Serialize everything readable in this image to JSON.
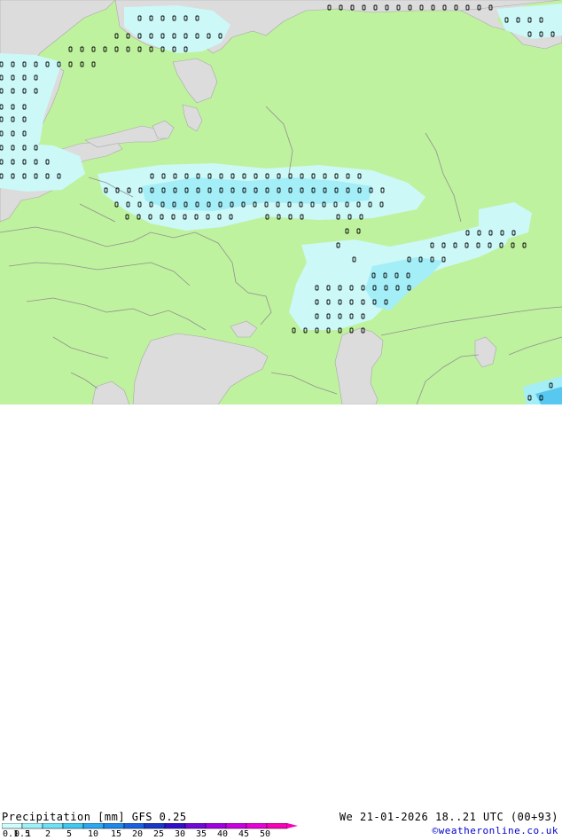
{
  "legend": {
    "title_left": "Precipitation [mm]  GFS 0.25",
    "title_right": "We 21-01-2026 18..21 UTC (00+93)",
    "credit": "©weatheronline.co.uk",
    "scale_labels": [
      "0.1",
      "0.5",
      "1",
      "2",
      "5",
      "10",
      "15",
      "20",
      "25",
      "30",
      "35",
      "40",
      "45",
      "50"
    ],
    "scale_colors": [
      "#cffcfc",
      "#a0f0f8",
      "#70e0f4",
      "#40c8f0",
      "#2aa8f0",
      "#1e88e8",
      "#1a60e0",
      "#1838c8",
      "#3010c8",
      "#7008d8",
      "#a000e0",
      "#c800e0",
      "#e800d8",
      "#f800b8"
    ]
  },
  "map": {
    "land_color": "#bff29e",
    "sea_color": "#dcdcdc",
    "precip_light": "#ccf8f8",
    "precip_medium": "#a4eef8",
    "precip_heavy": "#58c8f0",
    "border_color": "#909090"
  }
}
